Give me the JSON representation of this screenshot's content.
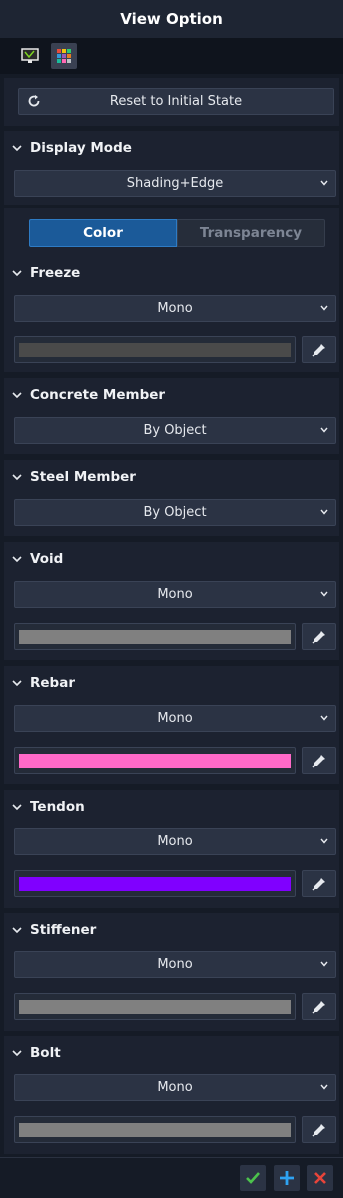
{
  "window": {
    "title": "View Option"
  },
  "toolbar": {
    "icons": [
      "display-settings-icon",
      "color-palette-icon"
    ]
  },
  "reset": {
    "label": "Reset to Initial State"
  },
  "display_mode": {
    "header": "Display Mode",
    "value": "Shading+Edge"
  },
  "tabs": {
    "color": "Color",
    "transparency": "Transparency",
    "active": "Color"
  },
  "sections": {
    "freeze": {
      "header": "Freeze",
      "mode": "Mono",
      "color": "#4a4a4a"
    },
    "concrete": {
      "header": "Concrete Member",
      "mode": "By Object"
    },
    "steel": {
      "header": "Steel Member",
      "mode": "By Object"
    },
    "void": {
      "header": "Void",
      "mode": "Mono",
      "color": "#808080"
    },
    "rebar": {
      "header": "Rebar",
      "mode": "Mono",
      "color": "#ff69c8"
    },
    "tendon": {
      "header": "Tendon",
      "mode": "Mono",
      "color": "#8000ff"
    },
    "stiffener": {
      "header": "Stiffener",
      "mode": "Mono",
      "color": "#808080"
    },
    "bolt": {
      "header": "Bolt",
      "mode": "Mono",
      "color": "#808080"
    }
  },
  "footer": {
    "buttons": [
      "ok-icon",
      "add-icon",
      "close-icon"
    ],
    "colors": {
      "ok": "#4cc24c",
      "add": "#2ea3f2",
      "close": "#e8443a"
    }
  }
}
